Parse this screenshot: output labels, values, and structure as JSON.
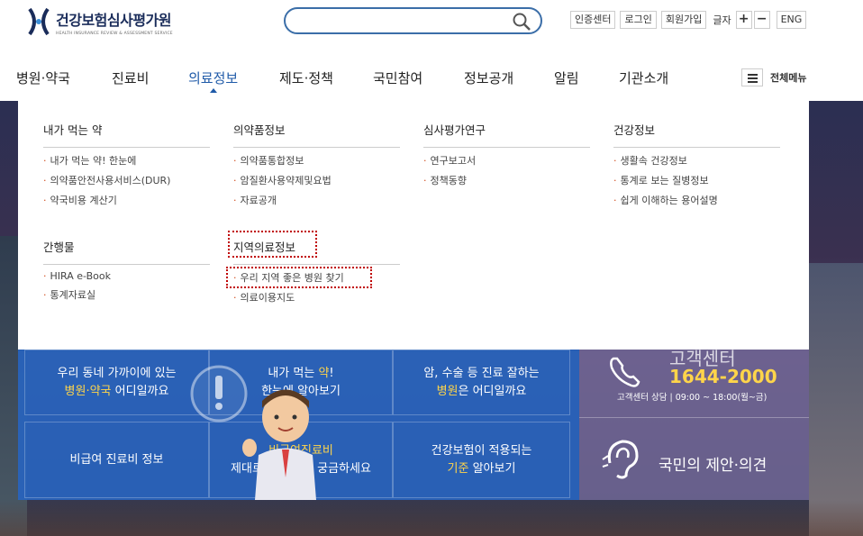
{
  "header": {
    "logo_title": "건강보험심사평가원",
    "logo_subtitle": "HEALTH INSURANCE REVIEW & ASSESSMENT SERVICE",
    "search_placeholder": "",
    "utils": [
      "인증센터",
      "로그인",
      "회원가입"
    ],
    "font_label": "글자",
    "font_plus": "+",
    "font_minus": "−",
    "lang": "ENG"
  },
  "gnb": {
    "items": [
      "병원·약국",
      "진료비",
      "의료정보",
      "제도·정책",
      "국민참여",
      "정보공개",
      "알림",
      "기관소개"
    ],
    "active_index": 2,
    "all_menu_label": "전체메뉴"
  },
  "mega": {
    "columns": [
      {
        "title": "내가 먹는 약",
        "links": [
          "내가 먹는 약! 한눈에",
          "의약품안전사용서비스(DUR)",
          "약국비용 계산기"
        ]
      },
      {
        "title": "의약품정보",
        "links": [
          "의약품통합정보",
          "암질환사용약제및요법",
          "자료공개"
        ]
      },
      {
        "title": "심사평가연구",
        "links": [
          "연구보고서",
          "정책동향"
        ]
      },
      {
        "title": "건강정보",
        "links": [
          "생활속 건강정보",
          "통계로 보는 질병정보",
          "쉽게 이해하는 용어설명"
        ]
      },
      {
        "title": "간행물",
        "links": [
          "HIRA e-Book",
          "통계자료실"
        ]
      },
      {
        "title": "지역의료정보",
        "links": [
          "우리 지역 좋은 병원 찾기",
          "의료이용지도"
        ]
      }
    ]
  },
  "tiles": {
    "t1": {
      "line1": "우리 동네 가까이에 있는",
      "line2_accent": "병원·약국",
      "line2_rest": " 어디일까요"
    },
    "t2": {
      "line1_pre": "내가 먹는 ",
      "line1_accent": "약",
      "line1_post": "!",
      "line2": "한눈에 알아보기"
    },
    "t3": {
      "line1": "암, 수술 등 진료 잘하는",
      "line2_accent": "병원",
      "line2_rest": "은 어디일까요"
    },
    "t4": {
      "line1": "비급여 진료비 정보"
    },
    "t5": {
      "line1_accent": "비급여진료비",
      "line2": "제대로 나온 건지 궁금하세요"
    },
    "t6": {
      "line1": "건강보험이 적용되는",
      "line2_accent": "기준",
      "line2_rest": " 알아보기"
    }
  },
  "right_panel": {
    "cc_title": "고객센터",
    "cc_phone": "1644-2000",
    "cc_hours": "고객센터 상담 | 09:00 ~ 18:00(월~금)",
    "proposal_label": "국민의 제안·의견"
  },
  "colors": {
    "brand_navy": "#1a2c5a",
    "active_blue": "#1f5aa8",
    "tile_blue": "#2864be",
    "accent_yellow": "#ffd54a",
    "highlight_red": "#c00000"
  }
}
